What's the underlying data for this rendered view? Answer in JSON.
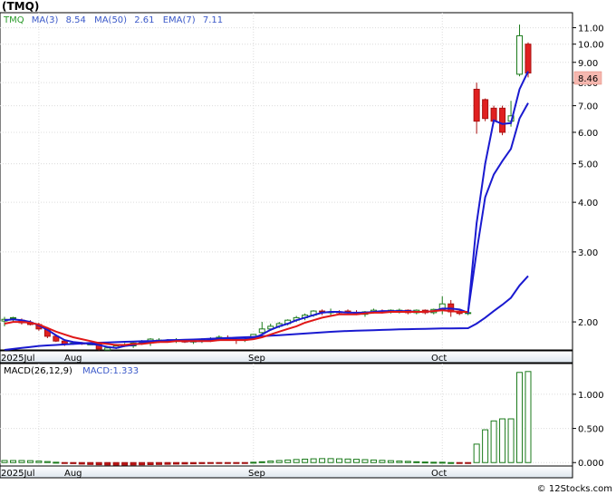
{
  "chart_data": [
    {
      "type": "candlestick",
      "title": "(TMQ)",
      "legend": {
        "symbol": "TMQ",
        "ma3_label": "MA(3)",
        "ma3_value": "8.54",
        "ma50_label": "MA(50)",
        "ma50_value": "2.61",
        "ema7_label": "EMA(7)",
        "ema7_value": "7.11"
      },
      "last_price_label": "8.46",
      "y_scale": "log",
      "ylim": [
        1.7,
        12.0
      ],
      "y_ticks": [
        "11.00",
        "10.00",
        "9.00",
        "8.00",
        "7.00",
        "6.00",
        "5.00",
        "4.00",
        "3.00",
        "2.00"
      ],
      "x_labels": [
        "2025Jul",
        "Aug",
        "Sep",
        "Oct"
      ],
      "candles": [
        {
          "o": 2.01,
          "h": 2.06,
          "l": 1.95,
          "c": 2.03
        },
        {
          "o": 2.04,
          "h": 2.06,
          "l": 2.0,
          "c": 2.05
        },
        {
          "o": 2.02,
          "h": 2.04,
          "l": 1.97,
          "c": 1.99
        },
        {
          "o": 1.99,
          "h": 2.02,
          "l": 1.96,
          "c": 1.97
        },
        {
          "o": 1.97,
          "h": 1.99,
          "l": 1.9,
          "c": 1.92
        },
        {
          "o": 1.92,
          "h": 1.94,
          "l": 1.82,
          "c": 1.84
        },
        {
          "o": 1.84,
          "h": 1.86,
          "l": 1.78,
          "c": 1.79
        },
        {
          "o": 1.79,
          "h": 1.81,
          "l": 1.74,
          "c": 1.76
        },
        {
          "o": 1.76,
          "h": 1.78,
          "l": 1.75,
          "c": 1.77
        },
        {
          "o": 1.77,
          "h": 1.78,
          "l": 1.75,
          "c": 1.76
        },
        {
          "o": 1.76,
          "h": 1.77,
          "l": 1.75,
          "c": 1.76
        },
        {
          "o": 1.76,
          "h": 1.76,
          "l": 1.69,
          "c": 1.71
        },
        {
          "o": 1.7,
          "h": 1.73,
          "l": 1.68,
          "c": 1.72
        },
        {
          "o": 1.72,
          "h": 1.76,
          "l": 1.71,
          "c": 1.74
        },
        {
          "o": 1.74,
          "h": 1.77,
          "l": 1.73,
          "c": 1.75
        },
        {
          "o": 1.74,
          "h": 1.79,
          "l": 1.72,
          "c": 1.77
        },
        {
          "o": 1.77,
          "h": 1.8,
          "l": 1.75,
          "c": 1.78
        },
        {
          "o": 1.77,
          "h": 1.82,
          "l": 1.74,
          "c": 1.81
        },
        {
          "o": 1.79,
          "h": 1.82,
          "l": 1.77,
          "c": 1.8
        },
        {
          "o": 1.8,
          "h": 1.81,
          "l": 1.78,
          "c": 1.79
        },
        {
          "o": 1.79,
          "h": 1.82,
          "l": 1.77,
          "c": 1.8
        },
        {
          "o": 1.8,
          "h": 1.81,
          "l": 1.77,
          "c": 1.78
        },
        {
          "o": 1.78,
          "h": 1.8,
          "l": 1.76,
          "c": 1.79
        },
        {
          "o": 1.79,
          "h": 1.82,
          "l": 1.77,
          "c": 1.8
        },
        {
          "o": 1.8,
          "h": 1.83,
          "l": 1.78,
          "c": 1.81
        },
        {
          "o": 1.81,
          "h": 1.85,
          "l": 1.79,
          "c": 1.83
        },
        {
          "o": 1.82,
          "h": 1.85,
          "l": 1.8,
          "c": 1.81
        },
        {
          "o": 1.81,
          "h": 1.83,
          "l": 1.76,
          "c": 1.8
        },
        {
          "o": 1.8,
          "h": 1.82,
          "l": 1.78,
          "c": 1.81
        },
        {
          "o": 1.82,
          "h": 1.86,
          "l": 1.81,
          "c": 1.86
        },
        {
          "o": 1.88,
          "h": 2.0,
          "l": 1.87,
          "c": 1.92
        },
        {
          "o": 1.92,
          "h": 1.98,
          "l": 1.9,
          "c": 1.95
        },
        {
          "o": 1.95,
          "h": 2.0,
          "l": 1.93,
          "c": 1.98
        },
        {
          "o": 1.98,
          "h": 2.03,
          "l": 1.96,
          "c": 2.02
        },
        {
          "o": 2.02,
          "h": 2.07,
          "l": 2.0,
          "c": 2.05
        },
        {
          "o": 2.05,
          "h": 2.1,
          "l": 2.02,
          "c": 2.08
        },
        {
          "o": 2.08,
          "h": 2.14,
          "l": 2.06,
          "c": 2.13
        },
        {
          "o": 2.13,
          "h": 2.15,
          "l": 2.08,
          "c": 2.12
        },
        {
          "o": 2.12,
          "h": 2.16,
          "l": 2.08,
          "c": 2.12
        },
        {
          "o": 2.12,
          "h": 2.14,
          "l": 2.09,
          "c": 2.11
        },
        {
          "o": 2.13,
          "h": 2.15,
          "l": 2.1,
          "c": 2.11
        },
        {
          "o": 2.11,
          "h": 2.14,
          "l": 2.08,
          "c": 2.09
        },
        {
          "o": 2.09,
          "h": 2.13,
          "l": 2.06,
          "c": 2.12
        },
        {
          "o": 2.12,
          "h": 2.16,
          "l": 2.1,
          "c": 2.14
        },
        {
          "o": 2.13,
          "h": 2.15,
          "l": 2.1,
          "c": 2.12
        },
        {
          "o": 2.12,
          "h": 2.15,
          "l": 2.1,
          "c": 2.14
        },
        {
          "o": 2.12,
          "h": 2.16,
          "l": 2.1,
          "c": 2.14
        },
        {
          "o": 2.14,
          "h": 2.15,
          "l": 2.09,
          "c": 2.11
        },
        {
          "o": 2.11,
          "h": 2.15,
          "l": 2.09,
          "c": 2.14
        },
        {
          "o": 2.14,
          "h": 2.15,
          "l": 2.09,
          "c": 2.11
        },
        {
          "o": 2.11,
          "h": 2.16,
          "l": 2.09,
          "c": 2.15
        },
        {
          "o": 2.15,
          "h": 2.32,
          "l": 2.09,
          "c": 2.22
        },
        {
          "o": 2.22,
          "h": 2.27,
          "l": 2.06,
          "c": 2.12
        },
        {
          "o": 2.13,
          "h": 2.15,
          "l": 2.08,
          "c": 2.1
        },
        {
          "o": 2.1,
          "h": 2.12,
          "l": 2.08,
          "c": 2.11
        },
        {
          "o": 7.7,
          "h": 8.0,
          "l": 5.95,
          "c": 6.4
        },
        {
          "o": 7.25,
          "h": 7.3,
          "l": 6.4,
          "c": 6.5
        },
        {
          "o": 6.9,
          "h": 7.0,
          "l": 6.3,
          "c": 6.4
        },
        {
          "o": 6.9,
          "h": 7.0,
          "l": 5.9,
          "c": 6.0
        },
        {
          "o": 6.4,
          "h": 7.2,
          "l": 6.2,
          "c": 6.6
        },
        {
          "o": 8.4,
          "h": 11.2,
          "l": 8.3,
          "c": 10.5
        },
        {
          "o": 10.0,
          "h": 10.1,
          "l": 8.25,
          "c": 8.46
        }
      ],
      "ema7": [
        1.98,
        2.0,
        2.0,
        1.99,
        1.97,
        1.93,
        1.89,
        1.86,
        1.83,
        1.81,
        1.79,
        1.77,
        1.76,
        1.75,
        1.75,
        1.76,
        1.76,
        1.77,
        1.78,
        1.78,
        1.79,
        1.79,
        1.79,
        1.79,
        1.79,
        1.8,
        1.8,
        1.8,
        1.8,
        1.81,
        1.83,
        1.86,
        1.89,
        1.92,
        1.95,
        1.99,
        2.02,
        2.05,
        2.07,
        2.09,
        2.09,
        2.09,
        2.1,
        2.11,
        2.11,
        2.12,
        2.12,
        2.12,
        2.12,
        2.12,
        2.13,
        2.14,
        2.13,
        2.12,
        2.12,
        3.0,
        4.12,
        4.7,
        5.08,
        5.45,
        6.5,
        7.11
      ],
      "ma3": [
        2.02,
        2.03,
        2.02,
        2.0,
        1.96,
        1.91,
        1.85,
        1.8,
        1.78,
        1.77,
        1.76,
        1.75,
        1.73,
        1.72,
        1.74,
        1.75,
        1.77,
        1.78,
        1.79,
        1.8,
        1.8,
        1.79,
        1.79,
        1.79,
        1.8,
        1.81,
        1.82,
        1.81,
        1.81,
        1.82,
        1.86,
        1.91,
        1.95,
        1.98,
        2.02,
        2.05,
        2.08,
        2.11,
        2.12,
        2.12,
        2.11,
        2.11,
        2.11,
        2.12,
        2.13,
        2.13,
        2.13,
        2.13,
        2.12,
        2.12,
        2.13,
        2.16,
        2.16,
        2.15,
        2.11,
        3.54,
        5.0,
        6.43,
        6.3,
        6.33,
        7.7,
        8.54
      ],
      "ma50": [
        1.7,
        1.71,
        1.72,
        1.73,
        1.74,
        1.745,
        1.75,
        1.755,
        1.76,
        1.765,
        1.77,
        1.773,
        1.776,
        1.779,
        1.782,
        1.785,
        1.788,
        1.79,
        1.793,
        1.796,
        1.8,
        1.803,
        1.806,
        1.81,
        1.814,
        1.818,
        1.822,
        1.826,
        1.83,
        1.834,
        1.84,
        1.846,
        1.852,
        1.858,
        1.864,
        1.87,
        1.876,
        1.882,
        1.888,
        1.893,
        1.897,
        1.9,
        1.903,
        1.906,
        1.909,
        1.912,
        1.915,
        1.917,
        1.919,
        1.921,
        1.923,
        1.925,
        1.926,
        1.927,
        1.928,
        1.98,
        2.05,
        2.13,
        2.21,
        2.3,
        2.47,
        2.61
      ]
    },
    {
      "type": "bar",
      "title": "MACD(26,12,9)",
      "legend_label": "MACD:1.333",
      "ylim": [
        -0.05,
        1.45
      ],
      "y_ticks": [
        "1.000",
        "0.500",
        "0.000"
      ],
      "x_labels": [
        "2025Jul",
        "Aug",
        "Sep",
        "Oct"
      ],
      "values": [
        0.03,
        0.03,
        0.03,
        0.028,
        0.022,
        0.015,
        0.005,
        -0.005,
        -0.015,
        -0.022,
        -0.028,
        -0.032,
        -0.035,
        -0.036,
        -0.036,
        -0.035,
        -0.033,
        -0.03,
        -0.028,
        -0.025,
        -0.022,
        -0.02,
        -0.018,
        -0.015,
        -0.012,
        -0.01,
        -0.008,
        -0.006,
        -0.003,
        0.005,
        0.012,
        0.022,
        0.03,
        0.038,
        0.045,
        0.05,
        0.055,
        0.058,
        0.058,
        0.055,
        0.052,
        0.048,
        0.043,
        0.038,
        0.033,
        0.028,
        0.022,
        0.018,
        0.012,
        0.008,
        0.005,
        0.005,
        0.0,
        -0.008,
        -0.012,
        0.27,
        0.48,
        0.61,
        0.64,
        0.64,
        1.32,
        1.333
      ]
    }
  ],
  "footer": {
    "copyright": "© 12Stocks.com"
  }
}
